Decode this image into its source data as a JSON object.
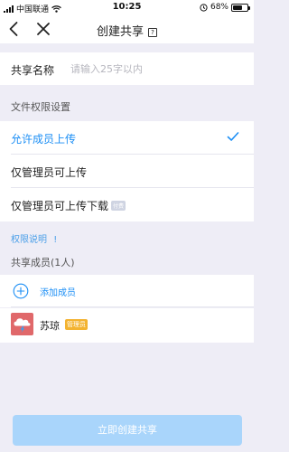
{
  "status_bar": {
    "carrier": "中国联通",
    "time": "10:25",
    "battery_percent": "68%",
    "battery_level": 0.68
  },
  "nav": {
    "title": "创建共享",
    "help_label": "?"
  },
  "share_name": {
    "label": "共享名称",
    "placeholder": "请输入25字以内",
    "value": ""
  },
  "permissions": {
    "header": "文件权限设置",
    "options": [
      {
        "label": "允许成员上传",
        "selected": true
      },
      {
        "label": "仅管理员可上传",
        "selected": false
      },
      {
        "label": "仅管理员可上传下载",
        "tag": "付费",
        "selected": false
      }
    ],
    "info_label": "权限说明"
  },
  "members": {
    "header": "共享成员(1人)",
    "add_label": "添加成员",
    "list": [
      {
        "name": "苏琼",
        "role": "管理员",
        "avatar": "cloud-lightning-icon"
      }
    ]
  },
  "footer": {
    "create_label": "立即创建共享"
  },
  "colors": {
    "accent": "#1b8ef5",
    "button_disabled": "#a9d5fb",
    "admin_badge": "#f3b331",
    "avatar_bg": "#e0686a",
    "page_bg": "#eeedf6"
  }
}
